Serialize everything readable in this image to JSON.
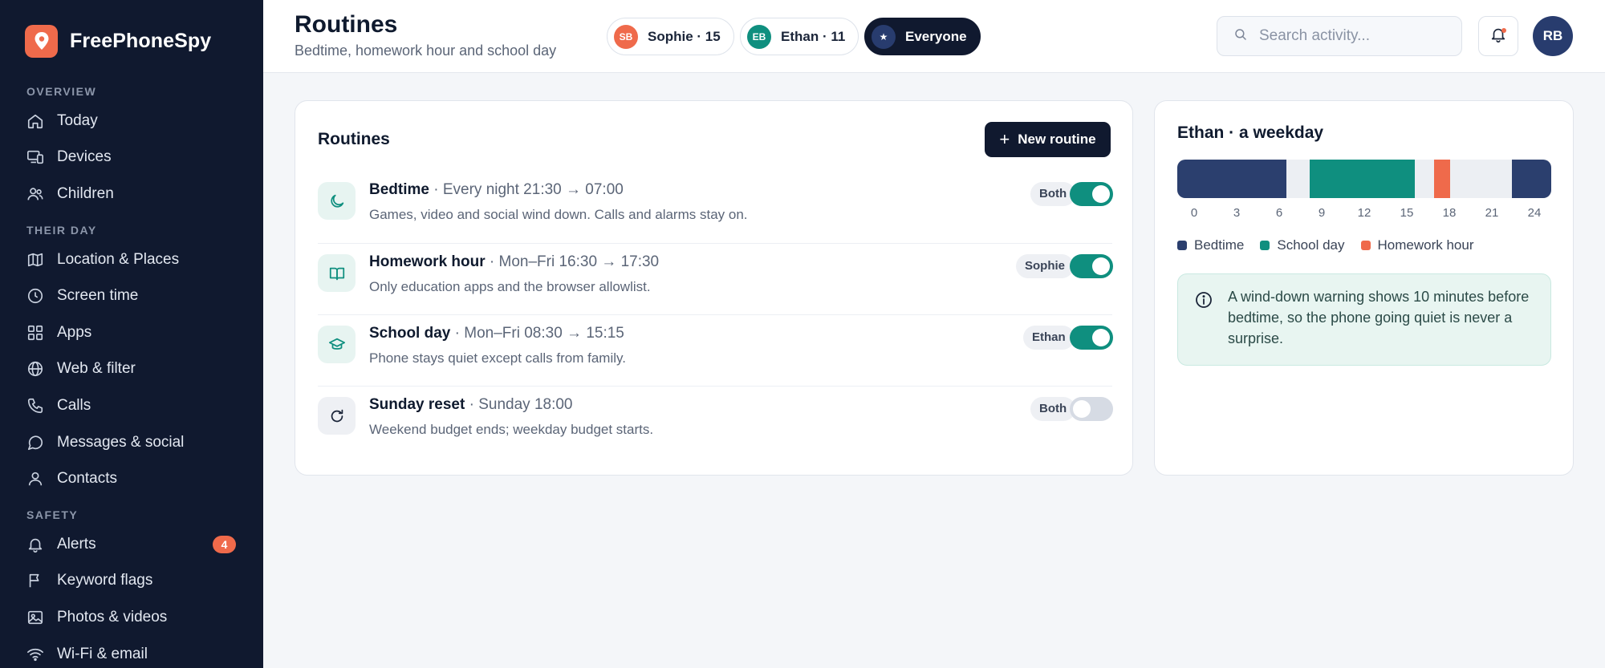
{
  "brand": {
    "name": "FreePhoneSpy"
  },
  "sidebar": {
    "sections": [
      {
        "title": "OVERVIEW",
        "items": [
          {
            "label": "Today",
            "icon": "home-icon"
          },
          {
            "label": "Devices",
            "icon": "devices-icon"
          },
          {
            "label": "Children",
            "icon": "users-icon"
          }
        ]
      },
      {
        "title": "THEIR DAY",
        "items": [
          {
            "label": "Location & Places",
            "icon": "map-icon"
          },
          {
            "label": "Screen time",
            "icon": "clock-icon"
          },
          {
            "label": "Apps",
            "icon": "apps-icon"
          },
          {
            "label": "Web & filter",
            "icon": "globe-icon"
          },
          {
            "label": "Calls",
            "icon": "phone-icon"
          },
          {
            "label": "Messages & social",
            "icon": "message-icon"
          },
          {
            "label": "Contacts",
            "icon": "contact-icon"
          }
        ]
      },
      {
        "title": "SAFETY",
        "items": [
          {
            "label": "Alerts",
            "icon": "bell-icon",
            "badge": "4"
          },
          {
            "label": "Keyword flags",
            "icon": "flag-icon"
          },
          {
            "label": "Photos & videos",
            "icon": "image-icon"
          },
          {
            "label": "Wi-Fi & email",
            "icon": "wifi-icon"
          }
        ]
      }
    ]
  },
  "header": {
    "title": "Routines",
    "subtitle": "Bedtime, homework hour and school day",
    "chips": [
      {
        "initials": "SB",
        "label": "Sophie · 15",
        "color": "#ef6a4b"
      },
      {
        "initials": "EB",
        "label": "Ethan · 11",
        "color": "#0f8f7f"
      },
      {
        "initials": "★",
        "label": "Everyone",
        "color": "#283c6e",
        "active": true
      }
    ],
    "search": {
      "placeholder": "Search activity..."
    },
    "user_initials": "RB"
  },
  "routines_card": {
    "title": "Routines",
    "new_button": "New routine",
    "plus": "+",
    "items": [
      {
        "name": "Bedtime",
        "separator": " · ",
        "schedule": "Every night 21:30 → 07:00",
        "description": "Games, video and social wind down. Calls and alarms stay on.",
        "tag": "Both",
        "enabled": true,
        "icon": "moon-icon"
      },
      {
        "name": "Homework hour",
        "separator": " · ",
        "schedule": "Mon–Fri 16:30 → 17:30",
        "description": "Only education apps and the browser allowlist.",
        "tag": "Sophie",
        "enabled": true,
        "icon": "book-icon"
      },
      {
        "name": "School day",
        "separator": " · ",
        "schedule": "Mon–Fri 08:30 → 15:15",
        "description": "Phone stays quiet except calls from family.",
        "tag": "Ethan",
        "enabled": true,
        "icon": "graduation-cap-icon"
      },
      {
        "name": "Sunday reset",
        "separator": " · ",
        "schedule": "Sunday 18:00",
        "description": "Weekend budget ends; weekday budget starts.",
        "tag": "Both",
        "enabled": false,
        "icon": "refresh-icon"
      }
    ]
  },
  "day_card": {
    "title": "Ethan · a weekday",
    "timeline": {
      "range_hours": [
        0,
        24
      ],
      "segments": [
        {
          "start": 0,
          "end": 7,
          "kind": "Bedtime",
          "color": "#2b3f6e"
        },
        {
          "start": 8.5,
          "end": 15.25,
          "kind": "School day",
          "color": "#0f8f7f"
        },
        {
          "start": 16.5,
          "end": 17.5,
          "kind": "Homework hour",
          "color": "#ef6a4b"
        },
        {
          "start": 21.5,
          "end": 24,
          "kind": "Bedtime",
          "color": "#2b3f6e"
        }
      ],
      "ticks": [
        "0",
        "3",
        "6",
        "9",
        "12",
        "15",
        "18",
        "21",
        "24"
      ]
    },
    "legend": [
      {
        "label": "Bedtime",
        "color": "#2b3f6e"
      },
      {
        "label": "School day",
        "color": "#0f8f7f"
      },
      {
        "label": "Homework hour",
        "color": "#ef6a4b"
      }
    ],
    "info": "A wind-down warning shows 10 minutes before bedtime, so the phone going quiet is never a surprise."
  },
  "colors": {
    "sidebar_bg": "#10192f",
    "accent_teal": "#0f8f7f",
    "accent_coral": "#ef6a4b",
    "navy": "#2b3f6e"
  }
}
